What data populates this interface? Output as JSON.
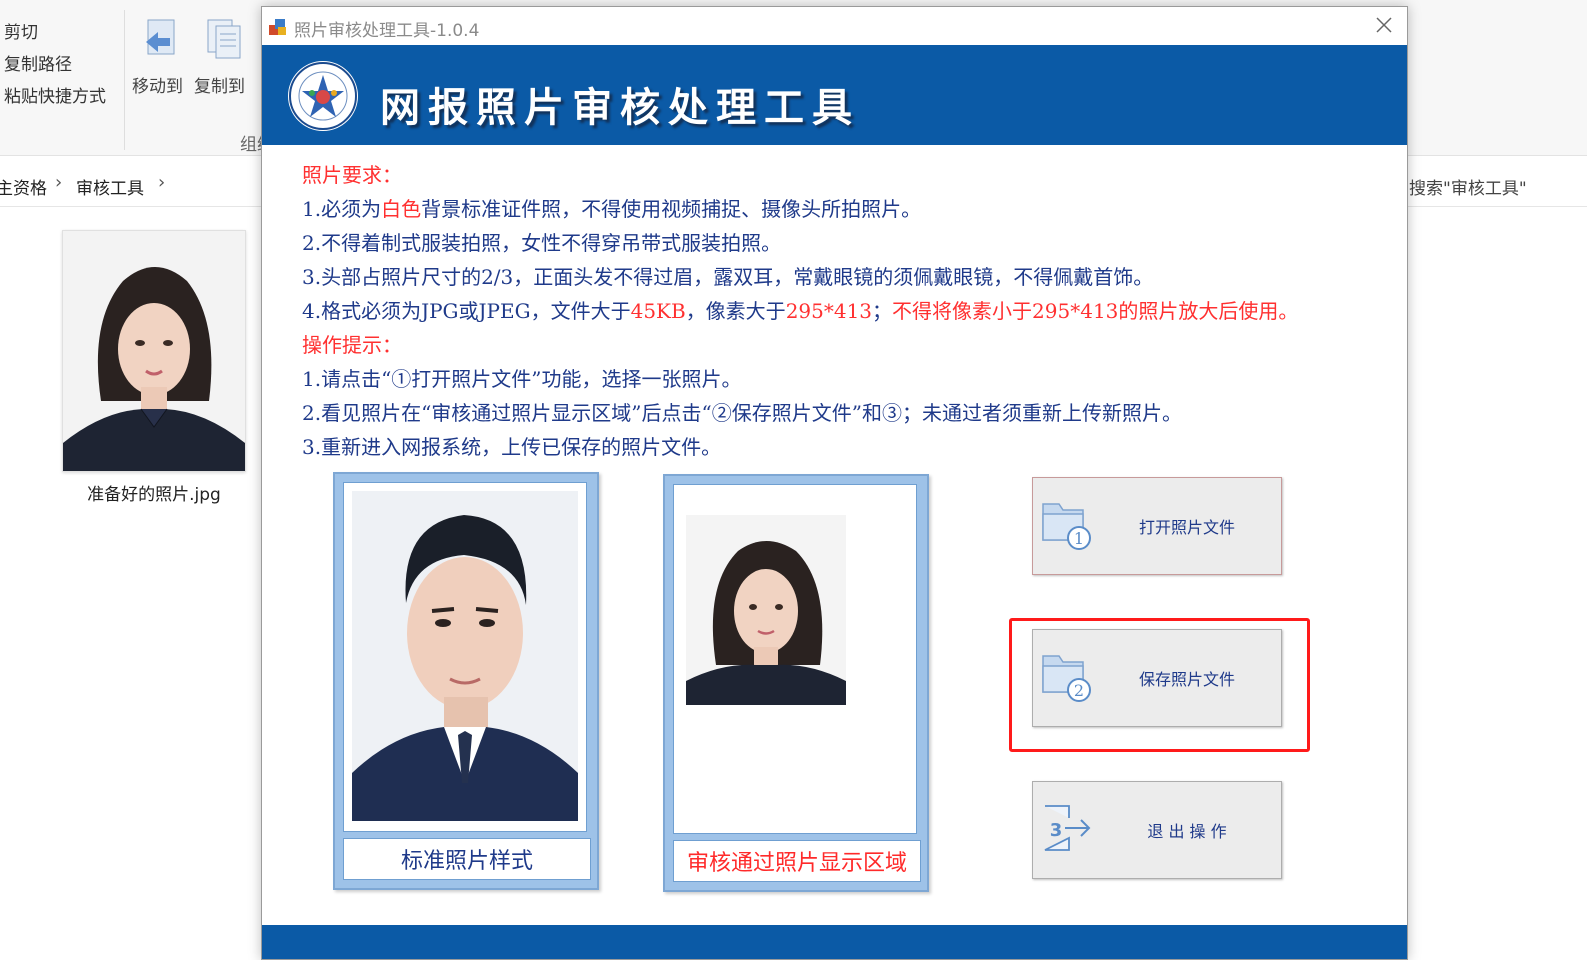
{
  "explorer": {
    "ribbon": {
      "cut": "剪切",
      "copy_path": "复制路径",
      "paste_shortcut": "粘贴快捷方式",
      "move_to": "移动到",
      "copy_to": "复制到",
      "group_label": "组织"
    },
    "breadcrumb": [
      "主资格",
      "审核工具"
    ],
    "search_placeholder": "搜索\"审核工具\"",
    "file": {
      "name": "准备好的照片.jpg"
    }
  },
  "dialog": {
    "title": "照片审核处理工具-1.0.4",
    "banner_title": "网报照片审核处理工具",
    "requirements_heading": "照片要求：",
    "requirements": [
      {
        "pre": "1.必须为",
        "red": "白色",
        "post": "背景标准证件照，不得使用视频捕捉、摄像头所拍照片。"
      },
      {
        "pre": "2.不得着制式服装拍照，女性不得穿吊带式服装拍照。"
      },
      {
        "pre": "3.头部占照片尺寸的2/3，正面头发不得过眉，露双耳，常戴眼镜的须佩戴眼镜，不得佩戴首饰。"
      },
      {
        "pre": "4.格式必须为JPG或JPEG，文件大于",
        "red": "45KB",
        "post": "，像素大于",
        "red2": "295*413",
        "post2": "；",
        "red3": "不得将像素小于295*413的照片放大后使用。"
      }
    ],
    "tips_heading": "操作提示：",
    "tips": [
      "1.请点击“①打开照片文件”功能，选择一张照片。",
      "2.看见照片在“审核通过照片显示区域”后点击“②保存照片文件”和③；未通过者须重新上传新照片。",
      "3.重新进入网报系统，上传已保存的照片文件。"
    ],
    "sample_caption": "标准照片样式",
    "approved_caption": "审核通过照片显示区域",
    "buttons": {
      "open": "打开照片文件",
      "save": "保存照片文件",
      "exit": "退 出 操 作"
    },
    "badges": {
      "open": "1",
      "save": "2",
      "exit": "3"
    }
  },
  "colors": {
    "banner": "#0b5aa6",
    "text_blue": "#1f3a8a",
    "text_red": "#ff3030",
    "highlight": "#ff1a1a"
  }
}
